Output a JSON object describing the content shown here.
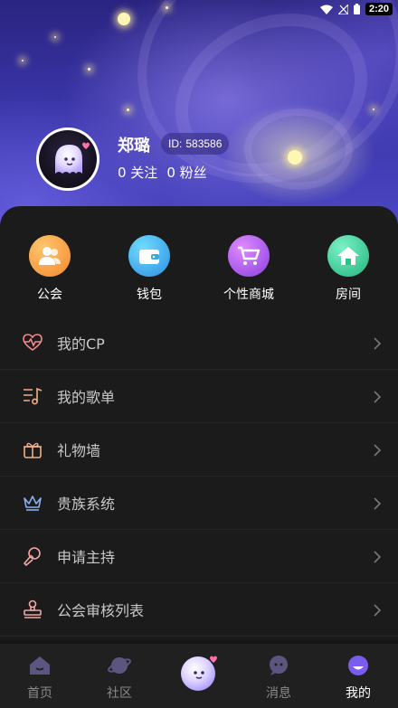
{
  "status_bar": {
    "time": "2:20"
  },
  "profile": {
    "name": "郑璐",
    "id_label": "ID:",
    "id_value": "583586",
    "following": "0 关注",
    "fans": "0 粉丝"
  },
  "quick_actions": [
    {
      "label": "公会",
      "icon": "users-icon",
      "color": "#f7a04a"
    },
    {
      "label": "钱包",
      "icon": "wallet-icon",
      "color": "#35b8e8"
    },
    {
      "label": "个性商城",
      "icon": "cart-icon",
      "color": "#b75de8"
    },
    {
      "label": "房间",
      "icon": "home-icon",
      "color": "#3fd39a"
    }
  ],
  "menu": [
    {
      "label": "我的CP",
      "icon": "heartbeat-icon"
    },
    {
      "label": "我的歌单",
      "icon": "playlist-icon"
    },
    {
      "label": "礼物墙",
      "icon": "gift-icon"
    },
    {
      "label": "贵族系统",
      "icon": "crown-icon"
    },
    {
      "label": "申请主持",
      "icon": "microphone-icon"
    },
    {
      "label": "公会审核列表",
      "icon": "stamp-icon"
    }
  ],
  "bottom_nav": [
    {
      "label": "首页",
      "icon": "home-icon",
      "active": false
    },
    {
      "label": "社区",
      "icon": "planet-icon",
      "active": false
    },
    {
      "label": "",
      "icon": "ghost-mascot-icon",
      "active": false
    },
    {
      "label": "消息",
      "icon": "chat-bubble-icon",
      "active": false
    },
    {
      "label": "我的",
      "icon": "profile-face-icon",
      "active": true
    }
  ]
}
